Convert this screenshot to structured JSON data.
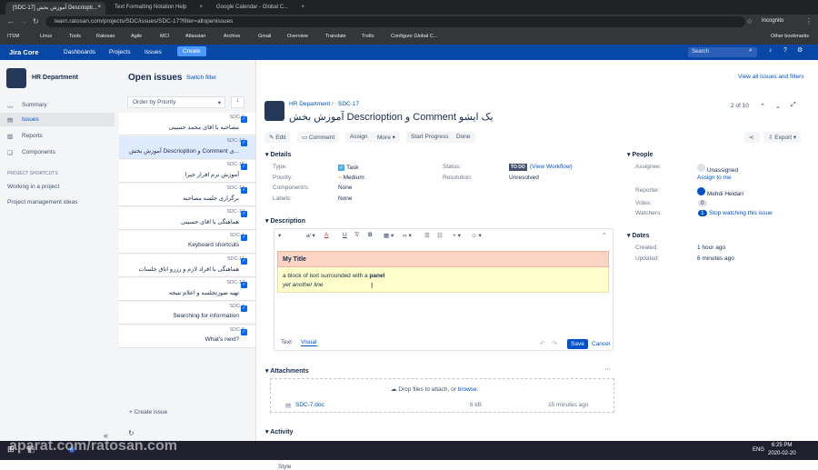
{
  "browser": {
    "tabs": [
      "[SDC-17] آموزش بخش Descriopti...",
      "Text Formatting Notation Help",
      "Google Calendar - Global C..."
    ],
    "url": "learn.ratosan.com/projects/SDC/issues/SDC-17?filter=allopenissues",
    "profile": "Incognito",
    "bookmarks": [
      "ITSM",
      "Linux",
      "Tools",
      "Ratosan",
      "Agile",
      "MCI",
      "Atlassian",
      "Archive",
      "Gmail",
      "Overview",
      "Translate",
      "Trello",
      "Configure Global C...",
      "Other bookmarks"
    ]
  },
  "nav": {
    "logo": "Jira Core",
    "items": [
      "Dashboards",
      "Projects",
      "Issues"
    ],
    "create": "Create",
    "search_placeholder": "Search"
  },
  "sidebar": {
    "project": "HR Department",
    "items": [
      "Summary",
      "Issues",
      "Reports",
      "Components"
    ],
    "section": "PROJECT SHORTCUTS",
    "shortcuts": [
      "Working in a project",
      "Project management ideas"
    ],
    "collapse": "«"
  },
  "list": {
    "title": "Open issues",
    "switch": "Switch filter",
    "order": "Order by Priority",
    "create": "+ Create issue",
    "items": [
      {
        "key": "SDC-9",
        "summary": "مصاحبه با اقای محمد حسینی"
      },
      {
        "key": "SDC-17",
        "summary": "آموزش بخش Descrioption و Comment ی..."
      },
      {
        "key": "SDC-15",
        "summary": "آموزش نرم افزار جیرا"
      },
      {
        "key": "SDC-13",
        "summary": "برگزاری جلسه مصاحبه"
      },
      {
        "key": "SDC-10",
        "summary": "هماهنگی با اقای حسینی"
      },
      {
        "key": "SDC-1",
        "summary": "Keyboard shortcuts"
      },
      {
        "key": "SDC-11",
        "summary": "هماهنگی با افراد لازم و رزرو اتاق جلسات"
      },
      {
        "key": "SDC-12",
        "summary": "تهیه صورتجلسه و اعلام نتیجه"
      },
      {
        "key": "SDC-4",
        "summary": "Searching for information"
      },
      {
        "key": "SDC-8",
        "summary": "What's next?"
      }
    ]
  },
  "issue": {
    "breadcrumb_project": "HR Department",
    "breadcrumb_key": "SDC-17",
    "title": "آموزش بخش Descrioption و Comment یک ایشو",
    "pager": "2 of 10",
    "view_all": "View all issues and filters",
    "buttons": [
      "Edit",
      "Comment",
      "Assign",
      "More",
      "Start Progress",
      "Done"
    ],
    "export": "Export",
    "details_hdr": "Details",
    "type_lbl": "Type:",
    "type": "Task",
    "priority_lbl": "Priority:",
    "priority": "Medium",
    "components_lbl": "Component/s:",
    "components": "None",
    "labels_lbl": "Labels:",
    "labels": "None",
    "status_lbl": "Status:",
    "status": "TO DO",
    "view_workflow": "(View Workflow)",
    "resolution_lbl": "Resolution:",
    "resolution": "Unresolved",
    "desc_hdr": "Description",
    "toolbar_style": "Style",
    "panel_title": "My Title",
    "line1a": "a block of text surrounded with a ",
    "line1b": "panel",
    "line2a": "yet ",
    "line2b": "another",
    "line2c": " line",
    "tab_text": "Text",
    "tab_visual": "Visual",
    "save": "Save",
    "cancel": "Cancel",
    "attach_hdr": "Attachments",
    "drop": "Drop files to attach, or ",
    "browse": "browse.",
    "file": "SDC-7.doc",
    "file_size": "6 kB",
    "file_time": "15 minutes ago",
    "activity_hdr": "Activity",
    "people_hdr": "People",
    "assignee_lbl": "Assignee:",
    "assignee": "Unassigned",
    "assign_me": "Assign to me",
    "reporter_lbl": "Reporter:",
    "reporter": "Mehdi Heidari",
    "votes_lbl": "Votes:",
    "votes": "0",
    "watchers_lbl": "Watchers:",
    "watchers": "1",
    "stop_watching": "Stop watching this issue",
    "dates_hdr": "Dates",
    "created_lbl": "Created:",
    "created": "1 hour ago",
    "updated_lbl": "Updated:",
    "updated": "6 minutes ago"
  },
  "taskbar": {
    "time": "6:25 PM",
    "date": "2020-02-20",
    "lang": "ENG",
    "watermark": "aparat.com/ratosan.com"
  }
}
